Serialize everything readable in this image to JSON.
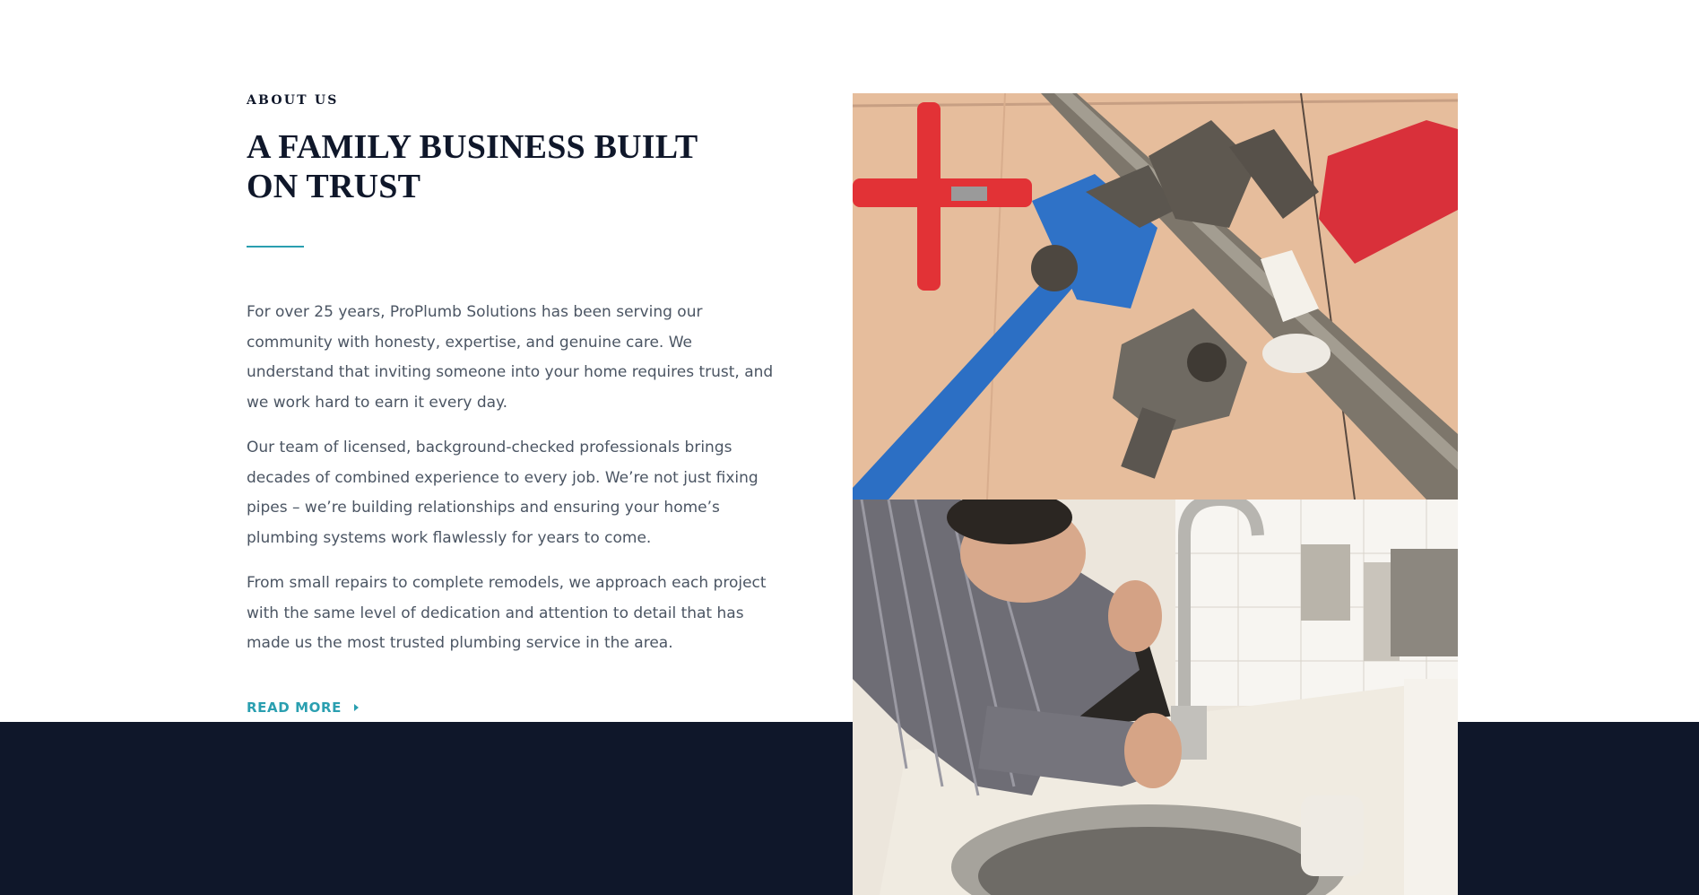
{
  "about": {
    "eyebrow": "ABOUT US",
    "heading": "A FAMILY BUSINESS BUILT ON TRUST",
    "paragraphs": [
      "For over 25 years, ProPlumb Solutions has been serving our community with honesty, expertise, and genuine care. We understand that inviting someone into your home requires trust, and we work hard to earn it every day.",
      "Our team of licensed, background-checked professionals brings decades of combined experience to every job. We’re not just fixing pipes – we’re building relationships and ensuring your home’s plumbing systems work flawlessly for years to come.",
      "From small repairs to complete remodels, we approach each project with the same level of dedication and attention to detail that has made us the most trusted plumbing service in the area."
    ],
    "read_more_label": "READ MORE",
    "read_more_icon": "caret-right-icon"
  },
  "images": {
    "top": {
      "subject": "pipe-wrenches-on-tile-photo"
    },
    "bottom": {
      "subject": "plumber-fixing-kitchen-faucet-photo"
    }
  },
  "colors": {
    "accent": "#2a9fb0",
    "heading": "#0f172a",
    "body_text": "#4b5563",
    "dark_band": "#0f172a"
  }
}
